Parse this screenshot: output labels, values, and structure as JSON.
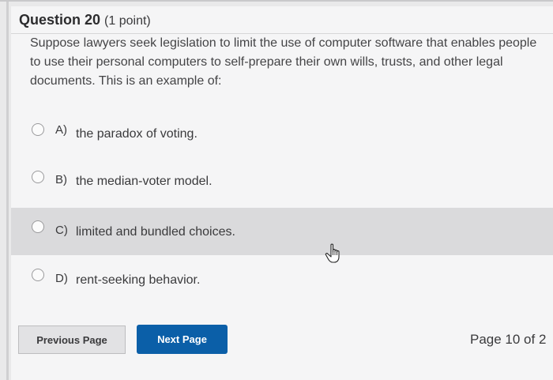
{
  "question": {
    "title": "Question 20",
    "points": "(1 point)",
    "prompt": "Suppose lawyers seek legislation to limit the use of computer software that enables people to use their personal computers to self-prepare their own wills, trusts, and other legal documents. This is an example of:"
  },
  "options": [
    {
      "letter": "A)",
      "text": "the paradox of voting."
    },
    {
      "letter": "B)",
      "text": "the median-voter model."
    },
    {
      "letter": "C)",
      "text": "limited and bundled choices."
    },
    {
      "letter": "D)",
      "text": "rent-seeking behavior."
    }
  ],
  "nav": {
    "previous_label": "Previous Page",
    "next_label": "Next Page",
    "page_indicator": "Page 10 of 2"
  },
  "colors": {
    "accent": "#0b5fa8",
    "highlight": "#dadadc"
  },
  "icons": {
    "cursor": "hand-pointer-icon"
  }
}
